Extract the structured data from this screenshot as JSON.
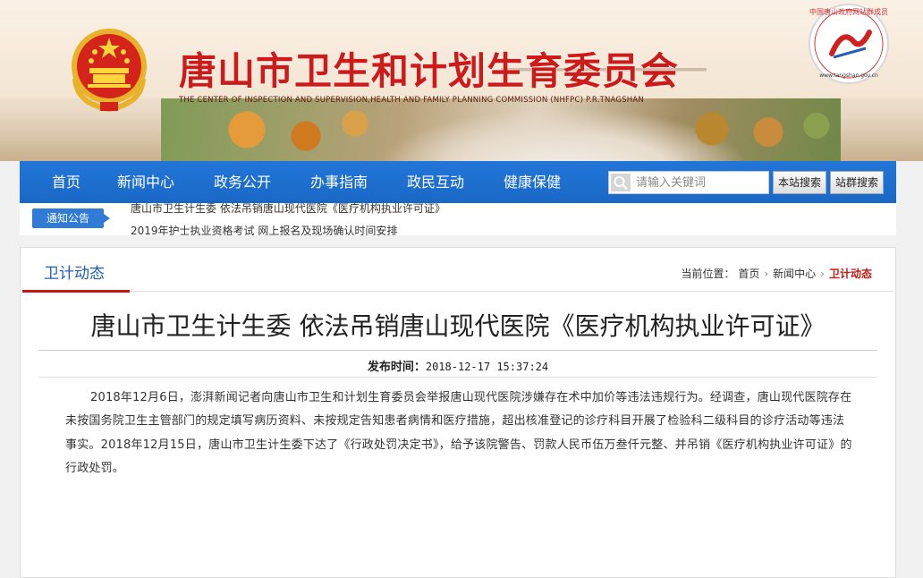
{
  "header": {
    "site_title": "唐山市卫生和计划生育委员会",
    "site_subtitle": "THE CENTER OF INSPECTION AND SUPERVISION,HEALTH AND FAMILY PLANNING COMMISSION (NHFPC) P.R.TNAGSHAN",
    "seal_text": "中国唐山政府网站群成员",
    "seal_url": "www.tangshan.gov.cn"
  },
  "nav": {
    "items": [
      {
        "label": "首页"
      },
      {
        "label": "新闻中心"
      },
      {
        "label": "政务公开"
      },
      {
        "label": "办事指南"
      },
      {
        "label": "政民互动"
      },
      {
        "label": "健康保健"
      }
    ],
    "search_placeholder": "请输入关键词",
    "site_search_label": "本站搜索",
    "group_search_label": "站群搜索"
  },
  "notice": {
    "badge": "通知公告",
    "lines": [
      "唐山市卫生计生委 依法吊销唐山现代医院《医疗机构执业许可证》",
      "2019年护士执业资格考试 网上报名及现场确认时间安排"
    ]
  },
  "section": {
    "tab_title": "卫计动态",
    "breadcrumb_label": "当前位置：",
    "breadcrumb": [
      "首页",
      "新闻中心",
      "卫计动态"
    ]
  },
  "article": {
    "title": "唐山市卫生计生委 依法吊销唐山现代医院《医疗机构执业许可证》",
    "pub_label": "发布时间：",
    "pub_time": "2018-12-17 15:37:24",
    "body": "2018年12月6日，澎湃新闻记者向唐山市卫生和计划生育委员会举报唐山现代医院涉嫌存在术中加价等违法违规行为。经调查，唐山现代医院存在未按国务院卫生主管部门的规定填写病历资料、未按规定告知患者病情和医疗措施，超出核准登记的诊疗科目开展了检验科二级科目的诊疗活动等违法事实。2018年12月15日，唐山市卫生计生委下达了《行政处罚决定书》，给予该院警告、罚款人民币伍万叁仟元整、并吊销《医疗机构执业许可证》的行政处罚。"
  },
  "colors": {
    "nav_blue": "#1c6ecf",
    "title_red": "#cf1a1a",
    "accent_red": "#c7160f",
    "badge_blue": "#2f7bd6"
  }
}
